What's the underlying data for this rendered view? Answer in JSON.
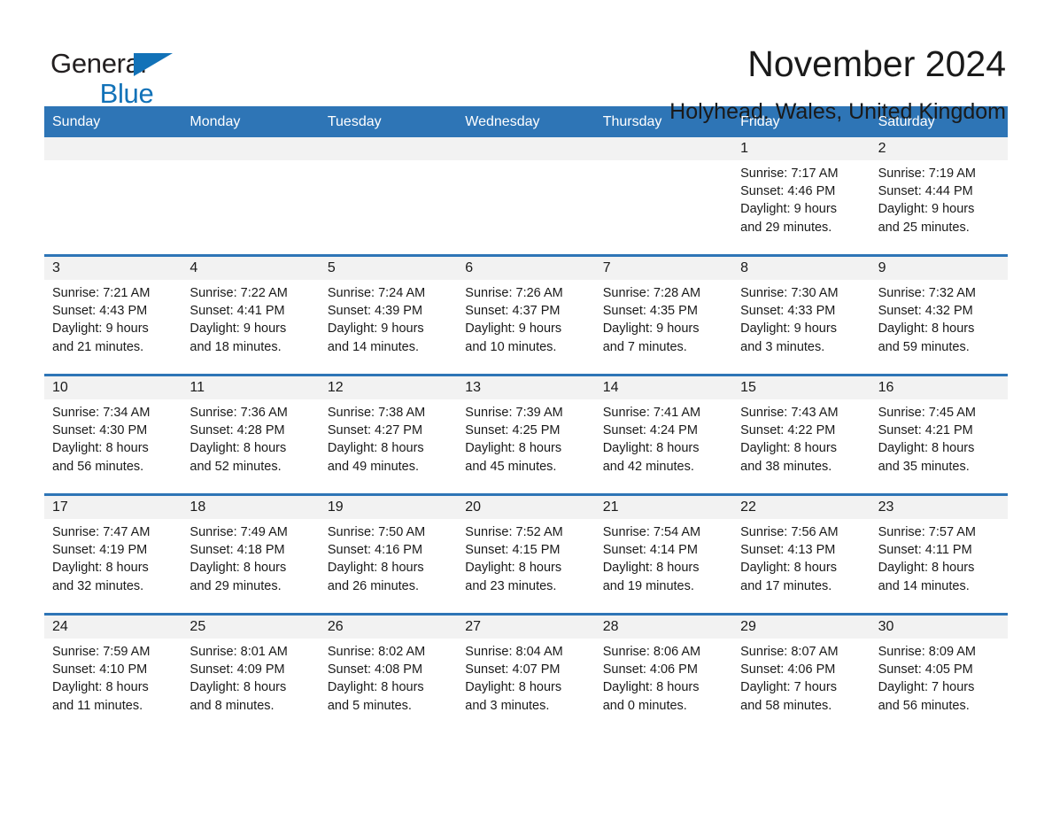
{
  "brand": {
    "name_line1": "General",
    "name_line2": "Blue",
    "flag_icon": "triangle-flag-icon"
  },
  "header": {
    "title": "November 2024",
    "location": "Holyhead, Wales, United Kingdom"
  },
  "calendar": {
    "weekdays": [
      "Sunday",
      "Monday",
      "Tuesday",
      "Wednesday",
      "Thursday",
      "Friday",
      "Saturday"
    ],
    "accent_color": "#2e75b6",
    "day_number_band_color": "#f2f2f2",
    "weeks": [
      [
        {
          "day": "",
          "sunrise": "",
          "sunset": "",
          "daylight_line1": "",
          "daylight_line2": ""
        },
        {
          "day": "",
          "sunrise": "",
          "sunset": "",
          "daylight_line1": "",
          "daylight_line2": ""
        },
        {
          "day": "",
          "sunrise": "",
          "sunset": "",
          "daylight_line1": "",
          "daylight_line2": ""
        },
        {
          "day": "",
          "sunrise": "",
          "sunset": "",
          "daylight_line1": "",
          "daylight_line2": ""
        },
        {
          "day": "",
          "sunrise": "",
          "sunset": "",
          "daylight_line1": "",
          "daylight_line2": ""
        },
        {
          "day": "1",
          "sunrise": "Sunrise: 7:17 AM",
          "sunset": "Sunset: 4:46 PM",
          "daylight_line1": "Daylight: 9 hours",
          "daylight_line2": "and 29 minutes."
        },
        {
          "day": "2",
          "sunrise": "Sunrise: 7:19 AM",
          "sunset": "Sunset: 4:44 PM",
          "daylight_line1": "Daylight: 9 hours",
          "daylight_line2": "and 25 minutes."
        }
      ],
      [
        {
          "day": "3",
          "sunrise": "Sunrise: 7:21 AM",
          "sunset": "Sunset: 4:43 PM",
          "daylight_line1": "Daylight: 9 hours",
          "daylight_line2": "and 21 minutes."
        },
        {
          "day": "4",
          "sunrise": "Sunrise: 7:22 AM",
          "sunset": "Sunset: 4:41 PM",
          "daylight_line1": "Daylight: 9 hours",
          "daylight_line2": "and 18 minutes."
        },
        {
          "day": "5",
          "sunrise": "Sunrise: 7:24 AM",
          "sunset": "Sunset: 4:39 PM",
          "daylight_line1": "Daylight: 9 hours",
          "daylight_line2": "and 14 minutes."
        },
        {
          "day": "6",
          "sunrise": "Sunrise: 7:26 AM",
          "sunset": "Sunset: 4:37 PM",
          "daylight_line1": "Daylight: 9 hours",
          "daylight_line2": "and 10 minutes."
        },
        {
          "day": "7",
          "sunrise": "Sunrise: 7:28 AM",
          "sunset": "Sunset: 4:35 PM",
          "daylight_line1": "Daylight: 9 hours",
          "daylight_line2": "and 7 minutes."
        },
        {
          "day": "8",
          "sunrise": "Sunrise: 7:30 AM",
          "sunset": "Sunset: 4:33 PM",
          "daylight_line1": "Daylight: 9 hours",
          "daylight_line2": "and 3 minutes."
        },
        {
          "day": "9",
          "sunrise": "Sunrise: 7:32 AM",
          "sunset": "Sunset: 4:32 PM",
          "daylight_line1": "Daylight: 8 hours",
          "daylight_line2": "and 59 minutes."
        }
      ],
      [
        {
          "day": "10",
          "sunrise": "Sunrise: 7:34 AM",
          "sunset": "Sunset: 4:30 PM",
          "daylight_line1": "Daylight: 8 hours",
          "daylight_line2": "and 56 minutes."
        },
        {
          "day": "11",
          "sunrise": "Sunrise: 7:36 AM",
          "sunset": "Sunset: 4:28 PM",
          "daylight_line1": "Daylight: 8 hours",
          "daylight_line2": "and 52 minutes."
        },
        {
          "day": "12",
          "sunrise": "Sunrise: 7:38 AM",
          "sunset": "Sunset: 4:27 PM",
          "daylight_line1": "Daylight: 8 hours",
          "daylight_line2": "and 49 minutes."
        },
        {
          "day": "13",
          "sunrise": "Sunrise: 7:39 AM",
          "sunset": "Sunset: 4:25 PM",
          "daylight_line1": "Daylight: 8 hours",
          "daylight_line2": "and 45 minutes."
        },
        {
          "day": "14",
          "sunrise": "Sunrise: 7:41 AM",
          "sunset": "Sunset: 4:24 PM",
          "daylight_line1": "Daylight: 8 hours",
          "daylight_line2": "and 42 minutes."
        },
        {
          "day": "15",
          "sunrise": "Sunrise: 7:43 AM",
          "sunset": "Sunset: 4:22 PM",
          "daylight_line1": "Daylight: 8 hours",
          "daylight_line2": "and 38 minutes."
        },
        {
          "day": "16",
          "sunrise": "Sunrise: 7:45 AM",
          "sunset": "Sunset: 4:21 PM",
          "daylight_line1": "Daylight: 8 hours",
          "daylight_line2": "and 35 minutes."
        }
      ],
      [
        {
          "day": "17",
          "sunrise": "Sunrise: 7:47 AM",
          "sunset": "Sunset: 4:19 PM",
          "daylight_line1": "Daylight: 8 hours",
          "daylight_line2": "and 32 minutes."
        },
        {
          "day": "18",
          "sunrise": "Sunrise: 7:49 AM",
          "sunset": "Sunset: 4:18 PM",
          "daylight_line1": "Daylight: 8 hours",
          "daylight_line2": "and 29 minutes."
        },
        {
          "day": "19",
          "sunrise": "Sunrise: 7:50 AM",
          "sunset": "Sunset: 4:16 PM",
          "daylight_line1": "Daylight: 8 hours",
          "daylight_line2": "and 26 minutes."
        },
        {
          "day": "20",
          "sunrise": "Sunrise: 7:52 AM",
          "sunset": "Sunset: 4:15 PM",
          "daylight_line1": "Daylight: 8 hours",
          "daylight_line2": "and 23 minutes."
        },
        {
          "day": "21",
          "sunrise": "Sunrise: 7:54 AM",
          "sunset": "Sunset: 4:14 PM",
          "daylight_line1": "Daylight: 8 hours",
          "daylight_line2": "and 19 minutes."
        },
        {
          "day": "22",
          "sunrise": "Sunrise: 7:56 AM",
          "sunset": "Sunset: 4:13 PM",
          "daylight_line1": "Daylight: 8 hours",
          "daylight_line2": "and 17 minutes."
        },
        {
          "day": "23",
          "sunrise": "Sunrise: 7:57 AM",
          "sunset": "Sunset: 4:11 PM",
          "daylight_line1": "Daylight: 8 hours",
          "daylight_line2": "and 14 minutes."
        }
      ],
      [
        {
          "day": "24",
          "sunrise": "Sunrise: 7:59 AM",
          "sunset": "Sunset: 4:10 PM",
          "daylight_line1": "Daylight: 8 hours",
          "daylight_line2": "and 11 minutes."
        },
        {
          "day": "25",
          "sunrise": "Sunrise: 8:01 AM",
          "sunset": "Sunset: 4:09 PM",
          "daylight_line1": "Daylight: 8 hours",
          "daylight_line2": "and 8 minutes."
        },
        {
          "day": "26",
          "sunrise": "Sunrise: 8:02 AM",
          "sunset": "Sunset: 4:08 PM",
          "daylight_line1": "Daylight: 8 hours",
          "daylight_line2": "and 5 minutes."
        },
        {
          "day": "27",
          "sunrise": "Sunrise: 8:04 AM",
          "sunset": "Sunset: 4:07 PM",
          "daylight_line1": "Daylight: 8 hours",
          "daylight_line2": "and 3 minutes."
        },
        {
          "day": "28",
          "sunrise": "Sunrise: 8:06 AM",
          "sunset": "Sunset: 4:06 PM",
          "daylight_line1": "Daylight: 8 hours",
          "daylight_line2": "and 0 minutes."
        },
        {
          "day": "29",
          "sunrise": "Sunrise: 8:07 AM",
          "sunset": "Sunset: 4:06 PM",
          "daylight_line1": "Daylight: 7 hours",
          "daylight_line2": "and 58 minutes."
        },
        {
          "day": "30",
          "sunrise": "Sunrise: 8:09 AM",
          "sunset": "Sunset: 4:05 PM",
          "daylight_line1": "Daylight: 7 hours",
          "daylight_line2": "and 56 minutes."
        }
      ]
    ]
  }
}
